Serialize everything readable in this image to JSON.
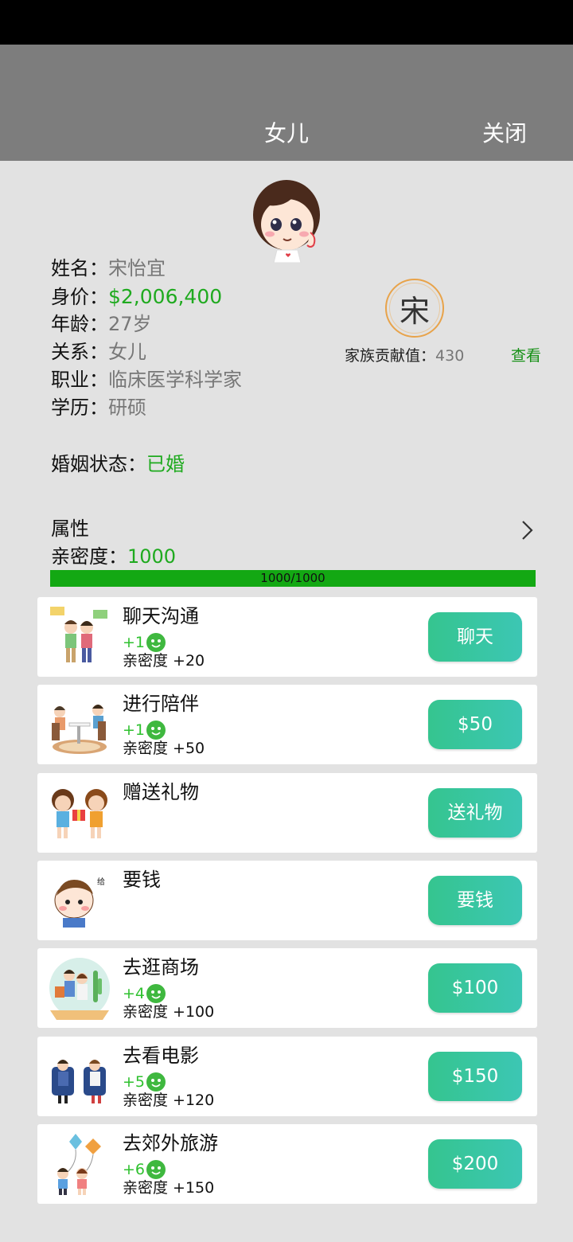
{
  "header": {
    "title": "女儿",
    "close_label": "关闭"
  },
  "profile": {
    "rows": [
      {
        "key": "姓名：",
        "value": "宋怡宜"
      },
      {
        "key": "身价：",
        "value": "$2,006,400"
      },
      {
        "key": "年龄：",
        "value": "27岁"
      },
      {
        "key": "关系：",
        "value": "女儿"
      },
      {
        "key": "职业：",
        "value": "临床医学科学家"
      },
      {
        "key": "学历：",
        "value": "研硕"
      }
    ],
    "marriage_key": "婚姻状态：",
    "marriage_value": "已婚"
  },
  "family": {
    "seal_char": "宋",
    "contrib_key": "家族贡献值：",
    "contrib_value": "430",
    "view_label": "查看"
  },
  "attributes": {
    "title": "属性",
    "intimacy_key": "亲密度：",
    "intimacy_value": "1000",
    "bar_text": "1000/1000",
    "bar_fraction": 1.0
  },
  "colors": {
    "accent_green": "#1faa1f",
    "button_from": "#35c58f",
    "button_to": "#3cc6b4",
    "header_bg": "#7d7d7d"
  },
  "actions": [
    {
      "title": "聊天沟通",
      "plus": "+1",
      "gain": "亲密度 +20",
      "button": "聊天",
      "icon": "chat-couple-icon"
    },
    {
      "title": "进行陪伴",
      "plus": "+1",
      "gain": "亲密度 +50",
      "button": "$50",
      "icon": "companionship-icon"
    },
    {
      "title": "赠送礼物",
      "plus": "",
      "gain": "",
      "button": "送礼物",
      "icon": "gift-kids-icon"
    },
    {
      "title": "要钱",
      "plus": "",
      "gain": "",
      "button": "要钱",
      "icon": "ask-money-icon",
      "sticker_text": "给点零钱"
    },
    {
      "title": "去逛商场",
      "plus": "+4",
      "gain": "亲密度 +100",
      "button": "$100",
      "icon": "shopping-icon"
    },
    {
      "title": "去看电影",
      "plus": "+5",
      "gain": "亲密度 +120",
      "button": "$150",
      "icon": "cinema-icon"
    },
    {
      "title": "去郊外旅游",
      "plus": "+6",
      "gain": "亲密度 +150",
      "button": "$200",
      "icon": "kite-trip-icon"
    }
  ]
}
